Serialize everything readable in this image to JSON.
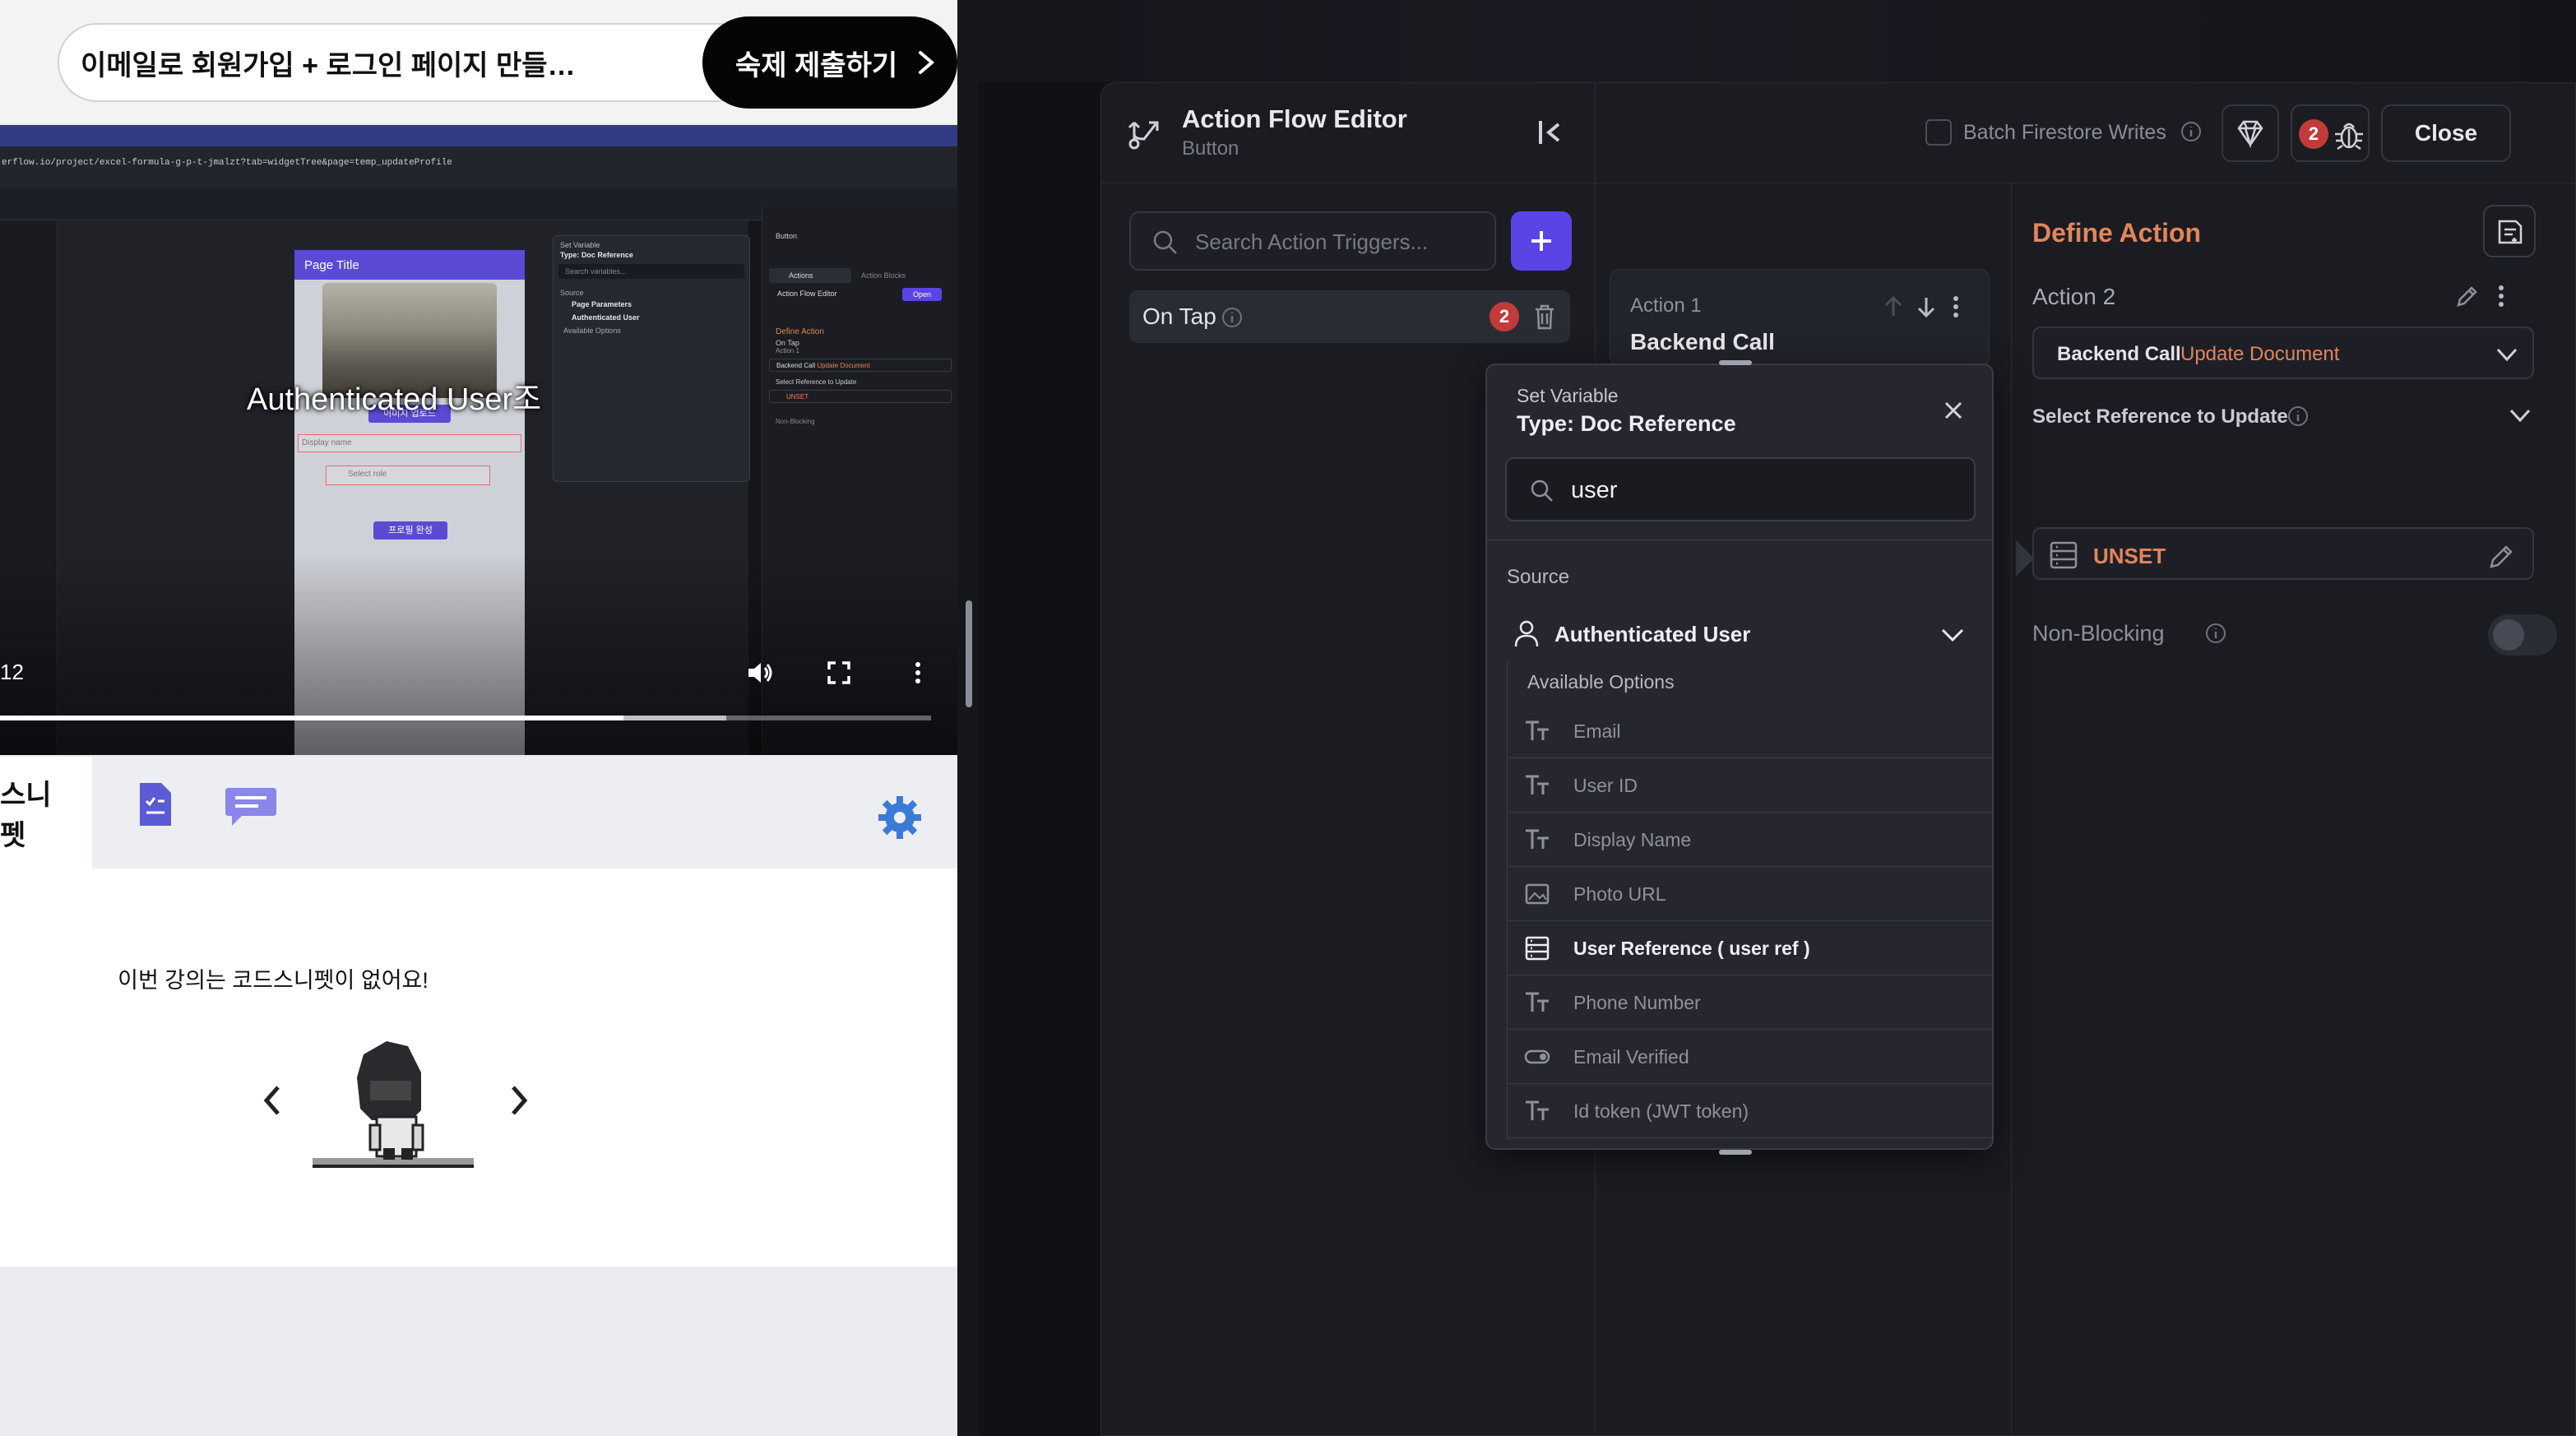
{
  "lecture": {
    "title": "이메일로 회원가입 + 로그인 페이지 만들…",
    "submit_label": "숙제 제출하기",
    "video": {
      "url_fragment": "erflow.io/project/excel-formula-g-p-t-jmalzt?tab=widgetTree&page=temp_updateProfile",
      "page_title": "Page Title",
      "image_button": "이미지 업로드",
      "display_name_placeholder": "Display name",
      "select_role_placeholder": "Select role",
      "save_button": "프로필 완성",
      "popup_label": "Set Variable",
      "popup_type": "Type: Doc Reference",
      "popup_search": "Search variables...",
      "popup_source": "Source",
      "popup_item_page": "Page Parameters",
      "popup_item_auth": "Authenticated User",
      "popup_available": "Available Options",
      "panel_button": "Button",
      "panel_actions": "Actions",
      "panel_action_blocks": "Action Blocks",
      "panel_afe": "Action Flow Editor",
      "panel_open": "Open",
      "panel_define": "Define Action",
      "panel_ontap": "On Tap",
      "panel_action1": "Action 1",
      "panel_backend": "Backend Call",
      "panel_update": "Update Document",
      "panel_ref": "Select Reference to Update",
      "panel_unset": "UNSET",
      "panel_nonblocking": "Non-Blocking",
      "caption": "Authenticated User조",
      "time": "12",
      "progress_fraction": 0.67,
      "buffered_fraction": 0.78
    },
    "tab_label": "스니펫",
    "no_snippet_text": "이번 강의는 코드스니펫이 없어요!",
    "colors": {
      "tab_icon": "#5b5bd6",
      "gear": "#3b7bd8"
    }
  },
  "editor": {
    "title": "Action Flow Editor",
    "subtitle": "Button",
    "batch_label": "Batch Firestore Writes",
    "bug_count": "2",
    "close_label": "Close",
    "search_placeholder": "Search Action Triggers...",
    "trigger": {
      "label": "On Tap",
      "count": "2"
    },
    "action1": {
      "label": "Action 1",
      "title": "Backend Call"
    },
    "define": {
      "title": "Define Action",
      "action_label": "Action 2",
      "backend_type": "Backend Call",
      "backend_value": "Update Document",
      "ref_label": "Select Reference to Update",
      "ref_value": "UNSET",
      "nonblocking_label": "Non-Blocking"
    },
    "set_variable": {
      "label": "Set Variable",
      "type": "Type: Doc Reference",
      "search_value": "user",
      "source_label": "Source",
      "source_value": "Authenticated User",
      "available_label": "Available Options",
      "options": [
        {
          "label": "Email",
          "icon": "text-type-icon",
          "highlight": false
        },
        {
          "label": "User ID",
          "icon": "text-type-icon",
          "highlight": false
        },
        {
          "label": "Display Name",
          "icon": "text-type-icon",
          "highlight": false
        },
        {
          "label": "Photo URL",
          "icon": "image-type-icon",
          "highlight": false
        },
        {
          "label": "User Reference   ( user ref )",
          "icon": "doc-ref-type-icon",
          "highlight": true
        },
        {
          "label": "Phone Number",
          "icon": "text-type-icon",
          "highlight": false
        },
        {
          "label": "Email Verified",
          "icon": "bool-type-icon",
          "highlight": false
        },
        {
          "label": "Id token (JWT token)",
          "icon": "text-type-icon",
          "highlight": false
        }
      ]
    },
    "colors": {
      "accent": "#5b44e6",
      "orange": "#e2855a",
      "badge": "#c33a3a"
    }
  }
}
